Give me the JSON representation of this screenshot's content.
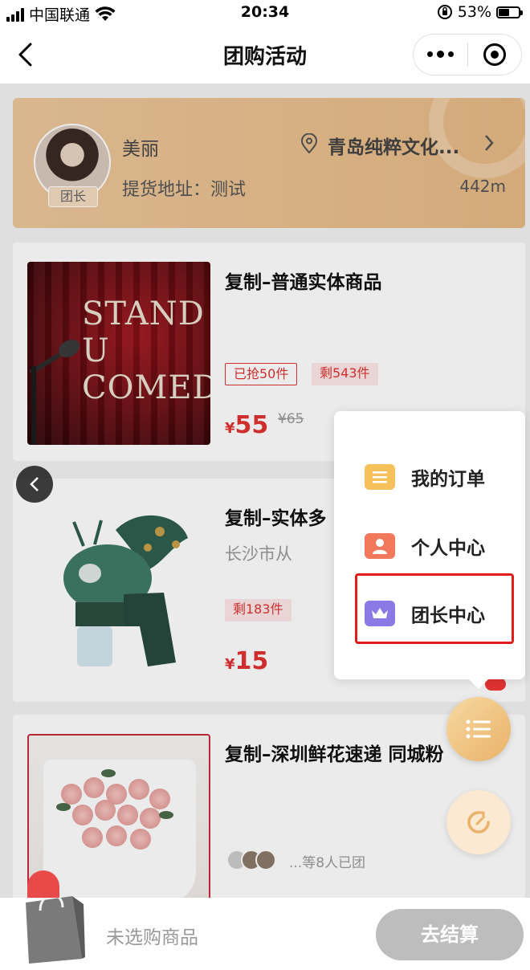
{
  "status_bar": {
    "carrier": "中国联通",
    "time": "20:34",
    "battery": "53%",
    "battery_level": 0.53
  },
  "nav": {
    "title": "团购活动"
  },
  "leader": {
    "name": "美丽",
    "tag": "团长",
    "store": "青岛纯粹文化...",
    "pickup": "提货地址：测试",
    "distance": "442m"
  },
  "products": [
    {
      "title": "复制–普通实体商品",
      "image_text": [
        "STAND U",
        "COMEDY"
      ],
      "tag_sold": "已抢50件",
      "tag_left": "剩543件",
      "currency": "¥",
      "price": "55",
      "old_price": "¥65"
    },
    {
      "title": "复制–实体多",
      "subtitle": "长沙市从",
      "tag_left": "剩183件",
      "currency": "¥",
      "price": "15"
    },
    {
      "title": "复制–深圳鲜花速递 同城粉",
      "joined": "...等8人已团"
    }
  ],
  "menu": {
    "items": [
      {
        "label": "我的订单",
        "color": "#f6c15b"
      },
      {
        "label": "个人中心",
        "color": "#f2785c"
      },
      {
        "label": "团长中心",
        "color": "#8b79e6"
      }
    ]
  },
  "bottom": {
    "cart_label": "未选购商品",
    "checkout_label": "去结算"
  },
  "colors": {
    "price": "#e03232",
    "highlight": "#e21b1b",
    "fab": "#e9b268"
  }
}
